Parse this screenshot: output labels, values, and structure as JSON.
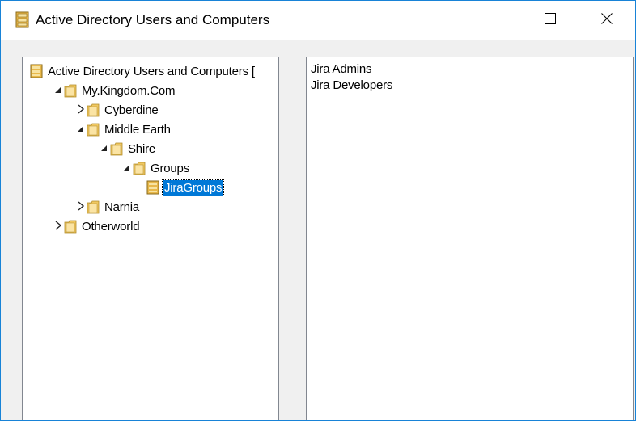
{
  "window": {
    "title": "Active Directory Users and Computers",
    "accent_color": "#1883d7",
    "selection_color": "#0078d7"
  },
  "titlebar": {
    "app_icon": "directory-book-icon",
    "minimize_icon": "minimize-icon",
    "maximize_icon": "maximize-icon",
    "close_icon": "close-icon"
  },
  "tree": {
    "items": [
      {
        "label": "Active Directory Users and Computers [",
        "icon": "directory-book-icon",
        "expander": ""
      },
      {
        "label": "My.Kingdom.Com",
        "icon": "folder-icon",
        "expander": "expanded"
      },
      {
        "label": "Cyberdine",
        "icon": "folder-icon",
        "expander": "collapsed"
      },
      {
        "label": "Middle Earth",
        "icon": "folder-icon",
        "expander": "expanded"
      },
      {
        "label": "Shire",
        "icon": "folder-icon",
        "expander": "expanded"
      },
      {
        "label": "Groups",
        "icon": "folder-icon",
        "expander": "expanded"
      },
      {
        "label": "JiraGroups",
        "icon": "directory-book-icon",
        "expander": "",
        "selected": true
      },
      {
        "label": "Narnia",
        "icon": "folder-icon",
        "expander": "collapsed"
      },
      {
        "label": "Otherworld",
        "icon": "folder-icon",
        "expander": "collapsed"
      }
    ]
  },
  "list": {
    "items": [
      {
        "label": "Jira Admins"
      },
      {
        "label": "Jira Developers"
      }
    ]
  }
}
